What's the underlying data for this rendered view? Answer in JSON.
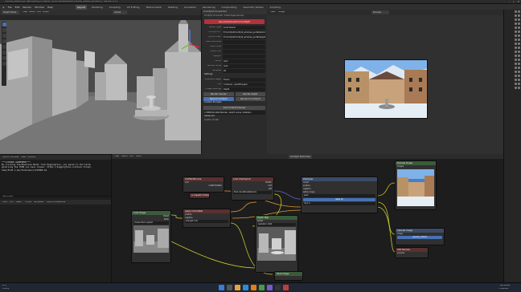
{
  "window": {
    "title": "Untitled_Save03_BP [Recovered] [C:\\Users\\...\\Documents\\Blender\\Untitled_Save03_BP.blend] - Blender 4.1.0"
  },
  "menubar": {
    "items": [
      "File",
      "Edit",
      "Render",
      "Window",
      "Help"
    ],
    "workspaces": [
      "Layout",
      "Modeling",
      "Sculpting",
      "UV Editing",
      "Texture Paint",
      "Shading",
      "Animation",
      "Rendering",
      "Compositing",
      "Geometry Nodes",
      "Scripting"
    ],
    "active_workspace": "Layout"
  },
  "viewport": {
    "mode": "Object Mode",
    "header_items": [
      "View",
      "Select",
      "Add",
      "Object"
    ],
    "transform": "Global"
  },
  "npanel": {
    "title": "ComfyUI Connector",
    "subtitle": "ComfyUI Connector: Install dependencies",
    "launch_button": "Launch/Connect to ComfyUI",
    "server_type_label": "Server Type",
    "server_type_value": "Local Server",
    "rows": [
      {
        "label": "ComfyUI P...",
        "value": "E:\\ComfyUI\\ComfyUI_windows_portable\\ComfyUI"
      },
      {
        "label": "Python Path",
        "value": "E:\\ComfyUI\\ComfyUI_windows_portable\\python_embeded"
      },
      {
        "label": "Main Workflow",
        "value": ""
      },
      {
        "label": "Main node",
        "value": ""
      },
      {
        "label": "Audio Fold",
        "value": ""
      },
      {
        "label": "Lipsync",
        "value": ""
      }
    ],
    "render_engine_label": "Audio",
    "render_engine_value": "Auto",
    "mode_label": "Render Mode",
    "mode_value": "Auto",
    "samples_label": "Samples",
    "samples_value": "20",
    "settings_label": "Settings",
    "preview_label": "Preview Images",
    "preview_value": "Frame",
    "file_label": "File",
    "file_value": "C:\\Users\\...\\workflow.json",
    "image_settings_label": "Image Settings",
    "depth_label": "Depth",
    "depth_value": "Depth",
    "btn_render_canvas": "Render Canvas",
    "btn_render_depth": "Render Depth",
    "btn_save_comfy": "Save to ComfyUI",
    "btn_render_to_comfy": "Render to ComfyUI",
    "btn_render_preview": "Add ComfyUI Preview",
    "custom_prompts": "Custom Prompts",
    "prompt_value": "A VERDIVA ARAI Blender, sketch scene, detailed...",
    "advanced_label": "Advanced",
    "loader_label": "Loader model"
  },
  "preview": {
    "view_label": "View",
    "image_label": "Image",
    "image_name": "Preview"
  },
  "console": {
    "header": [
      "Python Console",
      "View",
      "Console"
    ],
    "lines": [
      "***LICENSE AGREEMENT***",
      "By clicking Yes/Download Model from Huggingface, you agree to the terms",
      "governing the HiPW you have chosen: https://huggingface.co/black-forest-",
      "labs/FLUX.1-dev/blob/main/LICENSE.md"
    ]
  },
  "text_editor": {
    "title": "Text Editor",
    "menu": [
      "View",
      "Edit",
      "Select",
      "Format",
      "Templates",
      "Python Preferences"
    ]
  },
  "node_editor": {
    "header": [
      "View",
      "Select",
      "Add",
      "Node"
    ],
    "label": "ComfyUI Node Tree",
    "nodes": [
      {
        "id": "load",
        "title": "Load Image",
        "color": "#3b5b3b",
        "rows": [
          "IMAGE",
          "MASK",
          "choose file to upload"
        ]
      },
      {
        "id": "prompt",
        "title": "CLIPTextEncode",
        "color": "#5a3030",
        "rows": [
          "CLIP",
          "CONDITIONING",
          "a majestic fantasy city, cinematic lighting..."
        ]
      },
      {
        "id": "ckpt",
        "title": "Load Checkpoint",
        "color": "#5a3030",
        "rows": [
          "MODEL",
          "CLIP",
          "VAE",
          "flux1-dev-fp8.safetensors"
        ]
      },
      {
        "id": "ctrl",
        "title": "Apply ControlNet",
        "color": "#5a3030",
        "rows": [
          "positive",
          "negative",
          "control_net",
          "image",
          "strength 1.00"
        ]
      },
      {
        "id": "sampler",
        "title": "KSampler",
        "color": "#3b4b66",
        "rows": [
          "model",
          "positive",
          "negative",
          "latent_image",
          "seed",
          "steps 20",
          "cfg 1.0",
          "denoise 1.00"
        ]
      },
      {
        "id": "depth",
        "title": "Depth Map",
        "color": "#3b5b3b",
        "rows": [
          "IMAGE",
          "resolution 1024"
        ]
      },
      {
        "id": "save",
        "title": "Preview Image",
        "color": "#3b5b3b",
        "rows": [
          "images"
        ]
      },
      {
        "id": "upscale",
        "title": "Upscale Image",
        "color": "#3b4b66",
        "rows": [
          "image",
          "upscale_method",
          "width 1024",
          "height 1024"
        ]
      },
      {
        "id": "vae",
        "title": "VAE Decode",
        "color": "#5a3030",
        "rows": [
          "samples",
          "vae"
        ]
      },
      {
        "id": "out",
        "title": "Save Image",
        "color": "#3b5b3b",
        "rows": [
          "images",
          "ComfyUI"
        ]
      }
    ]
  },
  "taskbar": {
    "weather": "8°C",
    "weather_desc": "Cloudy",
    "time": "10:52 AM",
    "date": "7/30/2024"
  },
  "colors": {
    "accent_blue": "#4772b3",
    "accent_red": "#b3313a",
    "bg": "#1d1d1d"
  }
}
